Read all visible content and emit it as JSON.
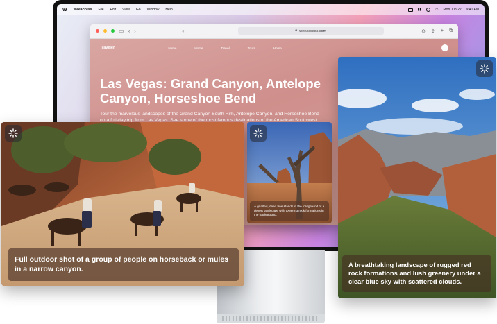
{
  "menubar": {
    "app_name": "Weeaccess",
    "items": [
      "File",
      "Edit",
      "View",
      "Go",
      "Window",
      "Help"
    ],
    "date": "Mon Jun 22",
    "time": "9:41 AM"
  },
  "browser": {
    "url": "weeaccess.com"
  },
  "site": {
    "logo": "Traveler.",
    "nav": [
      "Home",
      "Home",
      "Travel",
      "Tours",
      "Home"
    ],
    "title": "Las Vegas: Grand Canyon, Antelope Canyon, Horseshoe Bend",
    "description": "Tour the marvelous landscapes of the Grand Canyon South Rim, Antelope Canyon, and Horseshoe Bend on a full-day trip from Las Vegas. See some of the most famous destinations of the American Southwest."
  },
  "cards": {
    "mini": {
      "caption": "A gnarled, dead tree stands in the foreground of a desert landscape with towering rock formations in the background."
    },
    "horses": {
      "caption": "Full outdoor shot of a group of people on horseback or mules in a narrow canyon."
    },
    "canyon": {
      "caption": "A breathtaking landscape of rugged red rock formations and lush greenery under a clear blue sky with scattered clouds."
    }
  },
  "icons": {
    "sparkle": "sparkle-icon",
    "apple": "apple-logo-icon",
    "wifi": "wifi-icon",
    "battery": "battery-icon",
    "search": "search-icon"
  },
  "colors": {
    "dot_close": "#ff5f57",
    "dot_min": "#febc2e",
    "dot_max": "#28c840"
  }
}
